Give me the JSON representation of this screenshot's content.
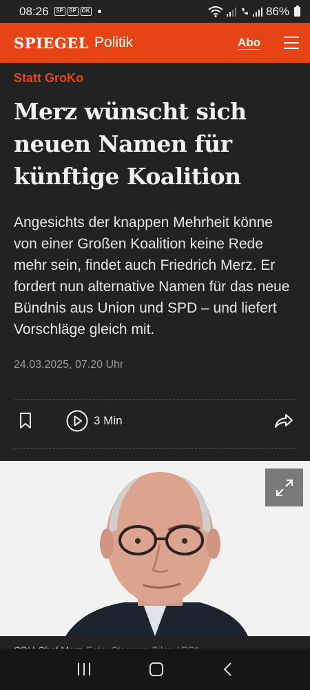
{
  "status_bar": {
    "time": "08:26",
    "battery": "86%",
    "notification_icons": [
      "SP",
      "SP",
      "OK"
    ]
  },
  "app_bar": {
    "logo": "SPIEGEL",
    "section": "Politik",
    "abo_label": "Abo",
    "menu_icon": "hamburger-icon"
  },
  "article": {
    "kicker": "Statt GroKo",
    "headline": "Merz wünscht sich neuen Namen für künftige Koalition",
    "teaser": "Angesichts der knappen Mehrheit könne von einer Großen Koalition keine Rede mehr sein, findet auch Friedrich Merz. Er fordert nun alternative Namen für das neue Bündnis aus Union und SPD – und liefert Vorschläge gleich mit.",
    "date": "24.03.2025, 07.20 Uhr",
    "read_time": "3 Min",
    "image_caption": "CDU-Chef Merz",
    "image_credit": "Foto: Clemens Bilan / EPA"
  },
  "colors": {
    "brand": "#e64415",
    "background": "#222222"
  }
}
